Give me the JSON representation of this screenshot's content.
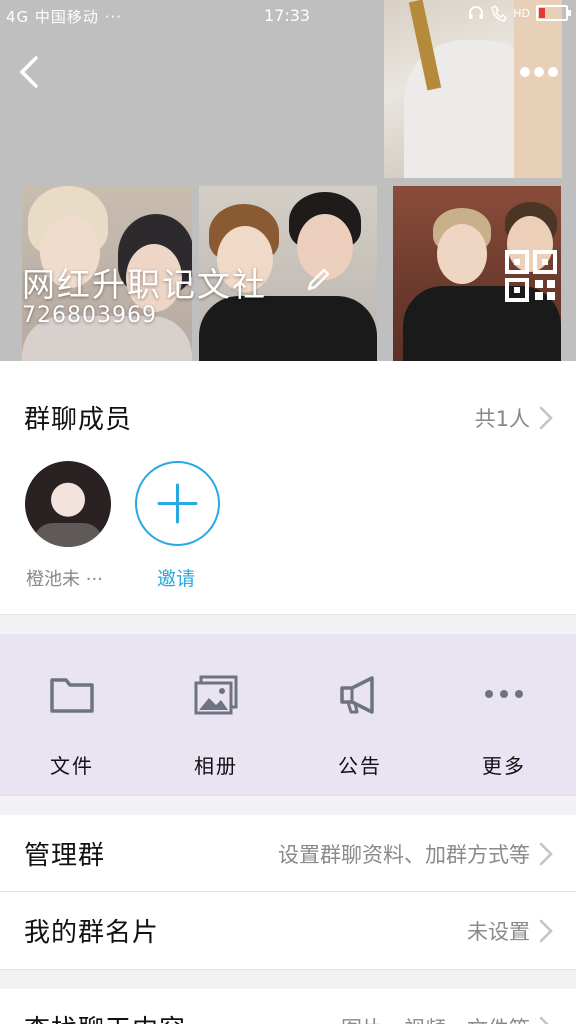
{
  "status_bar": {
    "carrier": "4G 中国移动 ···",
    "time": "17:33",
    "network": "HD"
  },
  "header": {
    "group_name": "网红升职记文社",
    "group_id": "726803969"
  },
  "members": {
    "title": "群聊成员",
    "count": "共1人",
    "items": [
      {
        "name": "橙池未 ···"
      }
    ],
    "invite_label": "邀请"
  },
  "toolbar": {
    "items": [
      {
        "label": "文件",
        "icon": "folder-icon"
      },
      {
        "label": "相册",
        "icon": "photo-album-icon"
      },
      {
        "label": "公告",
        "icon": "megaphone-icon"
      },
      {
        "label": "更多",
        "icon": "more-dots-icon"
      }
    ]
  },
  "settings": {
    "manage": {
      "label": "管理群",
      "value": "设置群聊资料、加群方式等"
    },
    "nickname": {
      "label": "我的群名片",
      "value": "未设置"
    },
    "files": {
      "label": "查找聊天内容",
      "value": "图片、视频、文件等"
    }
  },
  "colors": {
    "accent": "#27a9e1",
    "toolbar_bg": "#e9e3f2",
    "icon_gray": "#6d7480"
  }
}
